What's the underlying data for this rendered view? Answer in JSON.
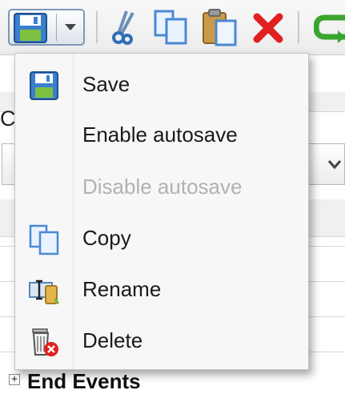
{
  "background": {
    "cut_letter": "C",
    "tree_toggle": "+",
    "tree_label": "End Events"
  },
  "menu": {
    "items": [
      {
        "label": "Save",
        "icon": "floppy-disk-icon",
        "enabled": true
      },
      {
        "label": "Enable autosave",
        "icon": "",
        "enabled": true
      },
      {
        "label": "Disable autosave",
        "icon": "",
        "enabled": false
      },
      {
        "label": "Copy",
        "icon": "copy-icon",
        "enabled": true
      },
      {
        "label": "Rename",
        "icon": "rename-icon",
        "enabled": true
      },
      {
        "label": "Delete",
        "icon": "trash-delete-icon",
        "enabled": true
      }
    ]
  },
  "toolbar": {
    "icons": [
      "floppy-disk-icon",
      "chevron-down-icon",
      "scissors-icon",
      "copy-icon",
      "paste-icon",
      "delete-x-icon",
      "redo-arrow-icon"
    ]
  },
  "colors": {
    "menu_background": "#f7f7f7",
    "disabled_text": "#b2b2b2",
    "delete_red": "#e02020",
    "floppy_blue": "#3b7fd1"
  }
}
